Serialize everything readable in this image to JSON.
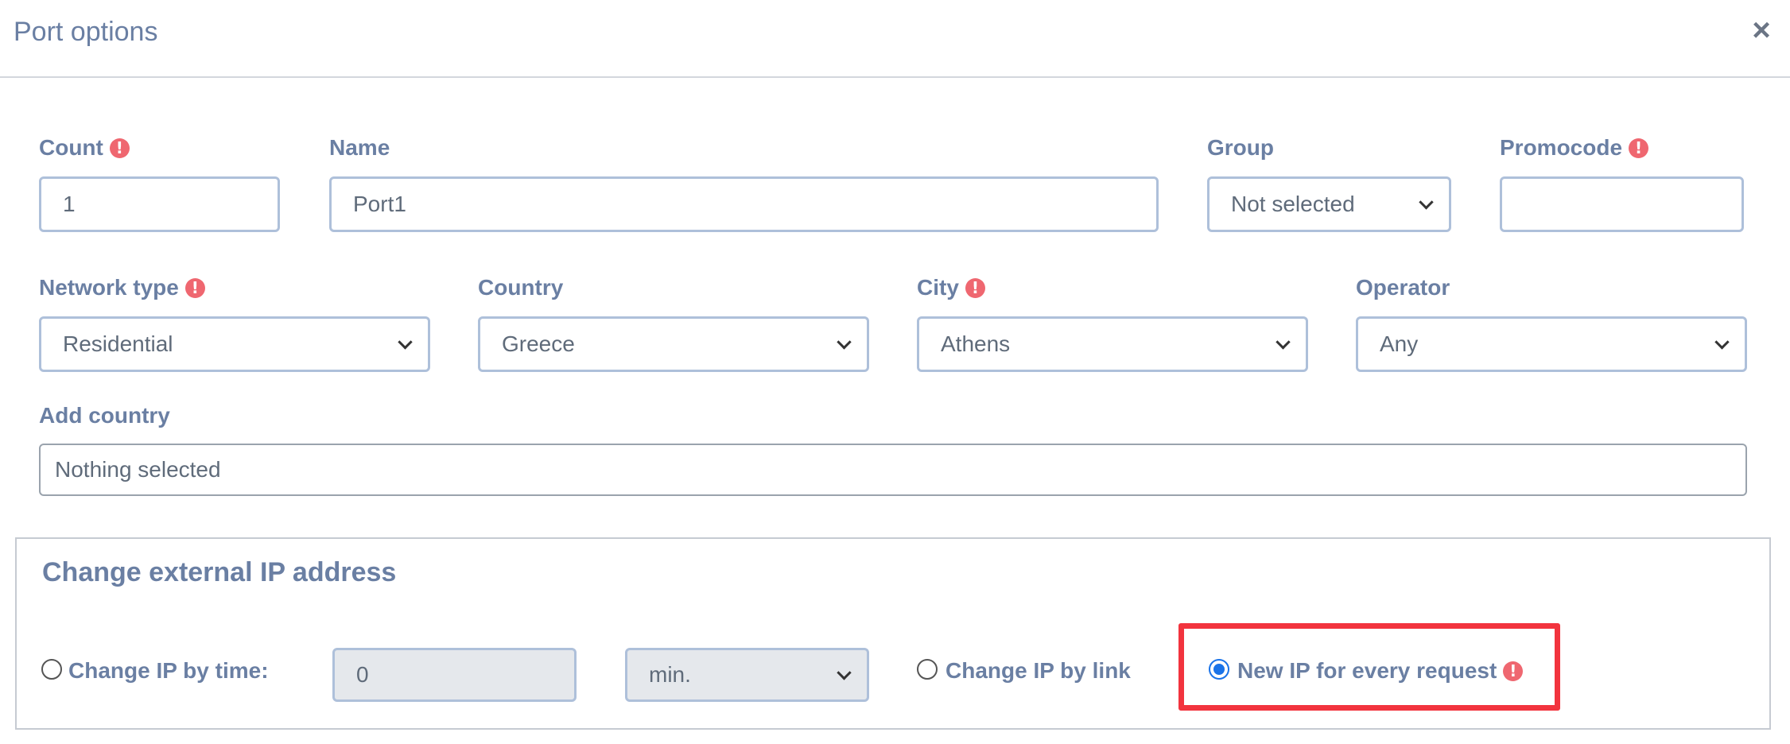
{
  "dialog": {
    "title": "Port options",
    "close_icon": "close-icon"
  },
  "form": {
    "count": {
      "label": "Count",
      "value": "1",
      "required": true
    },
    "name": {
      "label": "Name",
      "value": "Port1"
    },
    "group": {
      "label": "Group",
      "value": "Not selected"
    },
    "promocode": {
      "label": "Promocode",
      "value": "",
      "required": true
    },
    "network_type": {
      "label": "Network type",
      "value": "Residential",
      "required": true
    },
    "country": {
      "label": "Country",
      "value": "Greece"
    },
    "city": {
      "label": "City",
      "value": "Athens",
      "required": true
    },
    "operator": {
      "label": "Operator",
      "value": "Any"
    },
    "add_country": {
      "label": "Add country",
      "value": "Nothing selected"
    }
  },
  "ip_change": {
    "title": "Change external IP address",
    "by_time": {
      "label": "Change IP by time:",
      "value": "0",
      "unit": "min.",
      "checked": false
    },
    "by_link": {
      "label": "Change IP by link",
      "checked": false
    },
    "every_request": {
      "label": "New IP for every request",
      "checked": true,
      "required": true
    }
  },
  "colors": {
    "accent": "#1a73e8",
    "label": "#6a7fa3",
    "required": "#ef6770",
    "highlight": "#f2343e"
  }
}
